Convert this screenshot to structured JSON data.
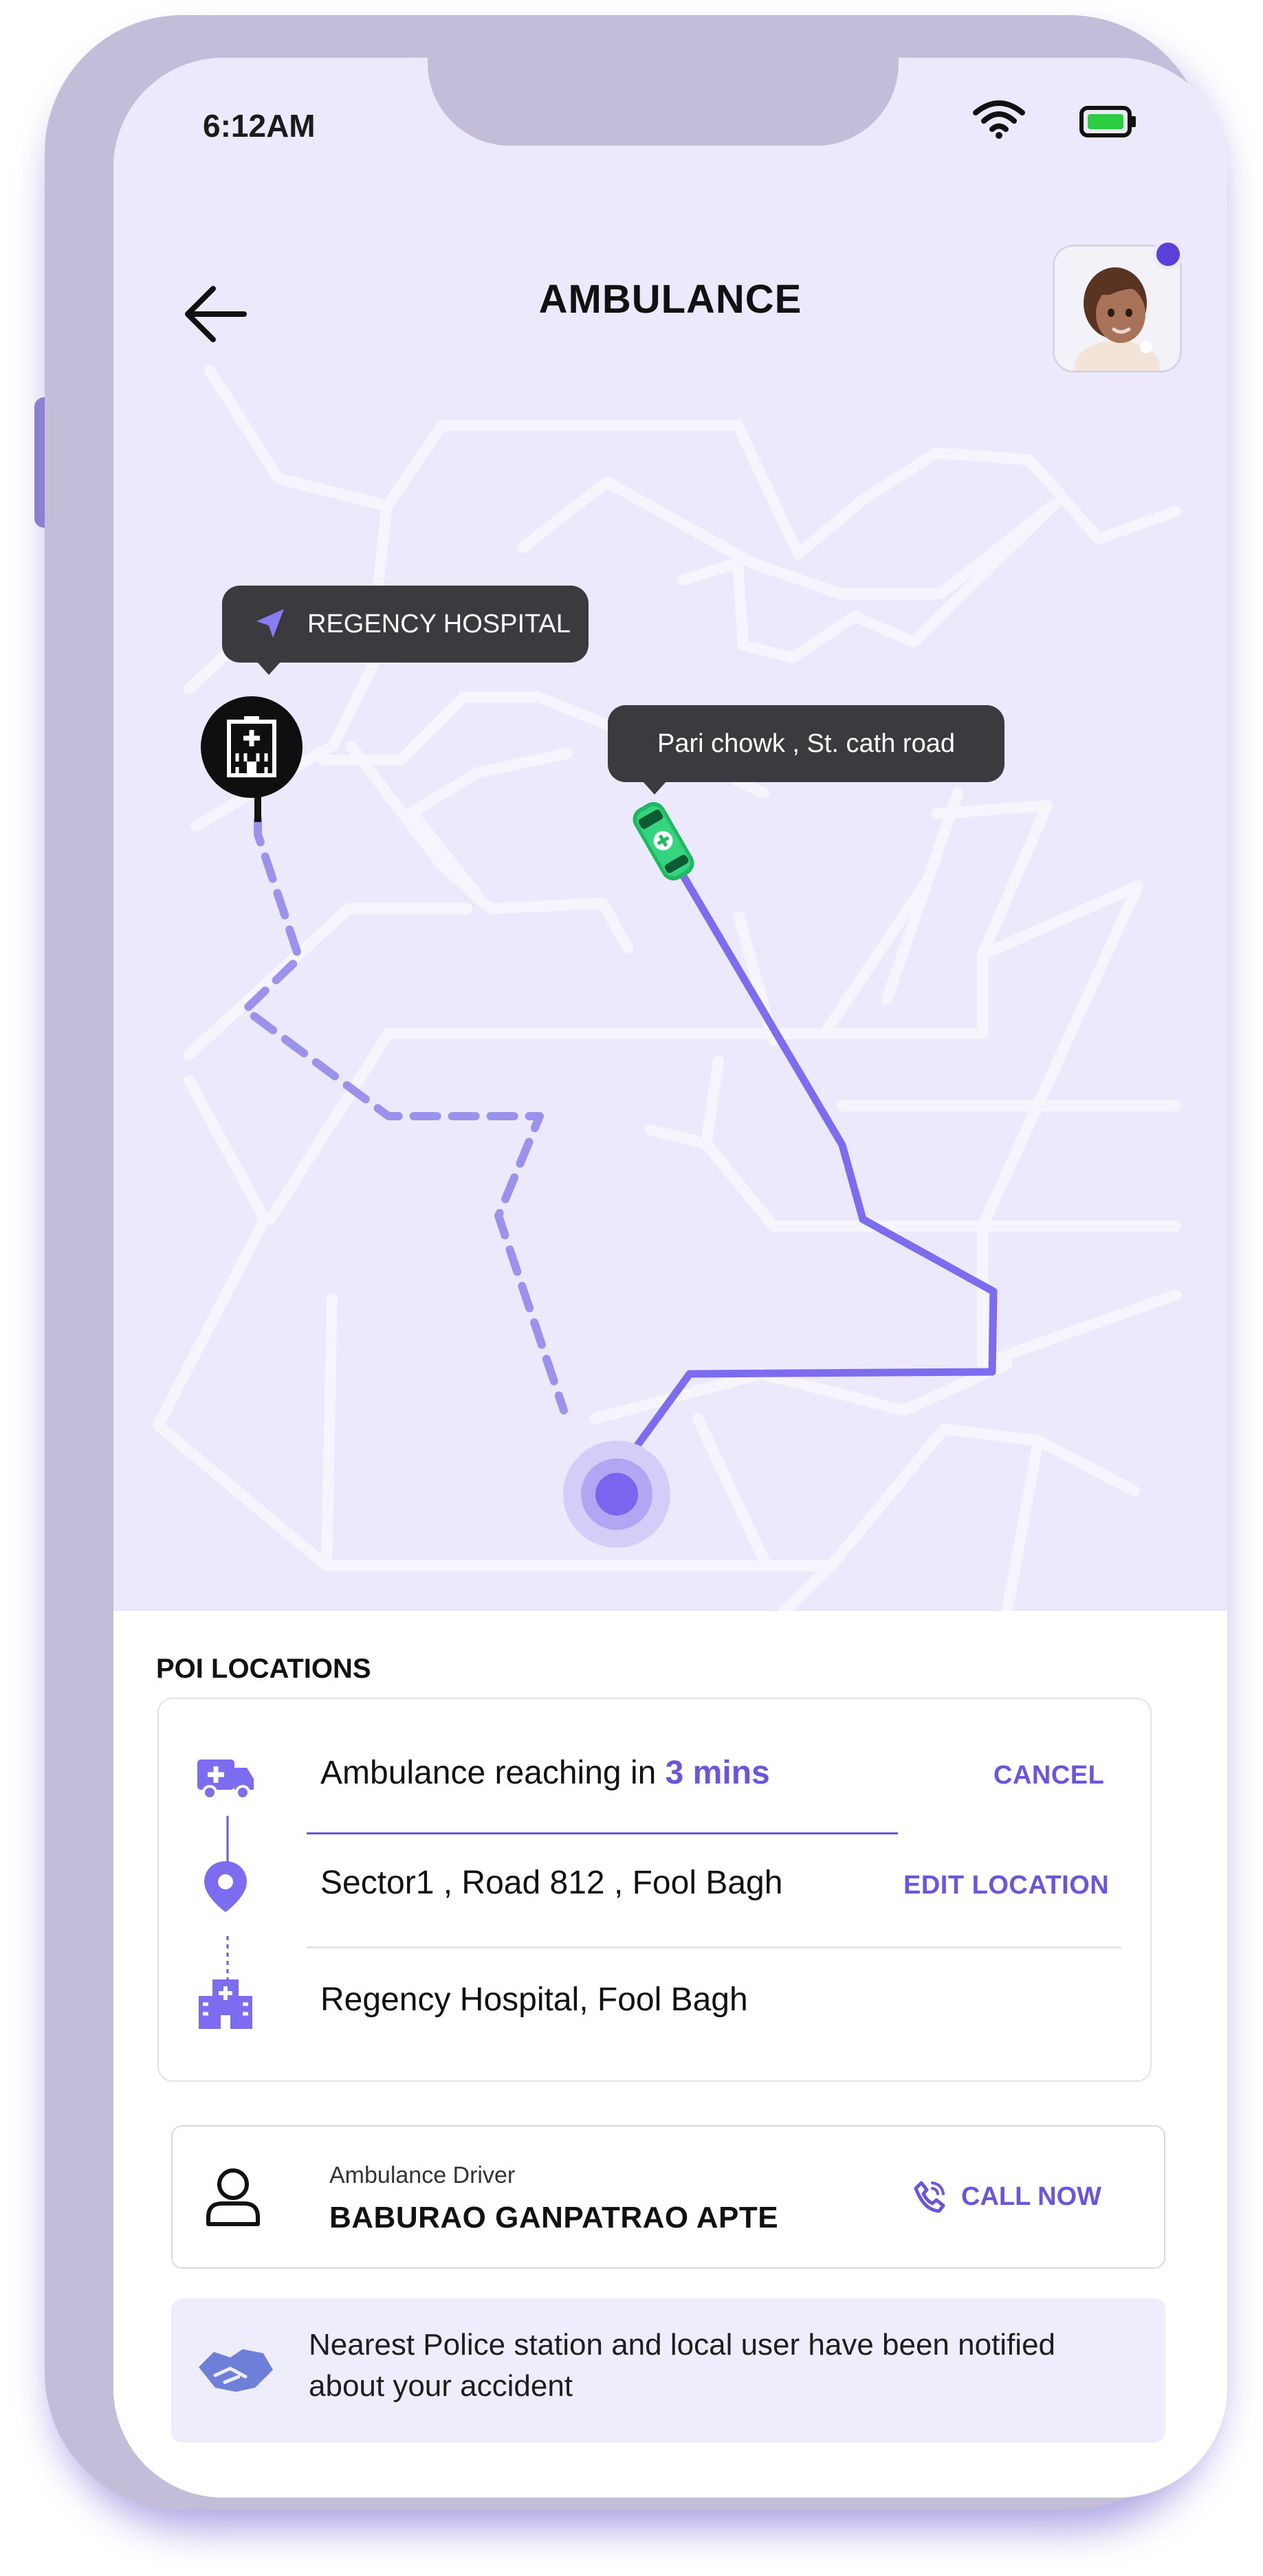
{
  "status_bar": {
    "time": "6:12AM",
    "wifi_icon": "wifi-icon",
    "battery_icon": "battery-icon"
  },
  "header": {
    "title": "AMBULANCE",
    "back_icon": "arrow-left-icon",
    "avatar": "user-avatar"
  },
  "map": {
    "hospital_tooltip": "REGENCY HOSPITAL",
    "ambulance_tooltip": "Pari chowk , St. cath road",
    "hospital_marker_icon": "hospital-icon",
    "ambulance_marker_icon": "ambulance-car-icon",
    "current_location_icon": "location-dot-icon",
    "route_color": "#7b6cf0",
    "suggested_route_color": "#9b92ee"
  },
  "poi": {
    "section_title": "POI LOCATIONS",
    "rows": [
      {
        "icon": "ambulance-icon",
        "text_prefix": "Ambulance reaching in ",
        "text_highlight": "3 mins",
        "action": "CANCEL"
      },
      {
        "icon": "map-pin-icon",
        "text": "Sector1 , Road 812 , Fool Bagh",
        "action": "EDIT LOCATION"
      },
      {
        "icon": "hospital-building-icon",
        "text": "Regency Hospital, Fool Bagh"
      }
    ]
  },
  "driver": {
    "label": "Ambulance Driver",
    "name": "BABURAO GANPATRAO APTE",
    "call_label": "CALL NOW",
    "user_icon": "user-icon",
    "call_icon": "phone-call-icon"
  },
  "notice": {
    "icon": "handshake-icon",
    "text": "Nearest Police station and local user have been notified about your accident"
  },
  "colors": {
    "accent": "#6a55de",
    "map_bg": "#ece9fc",
    "frame": "#c3bdda",
    "ambulance": "#2ecc71"
  }
}
